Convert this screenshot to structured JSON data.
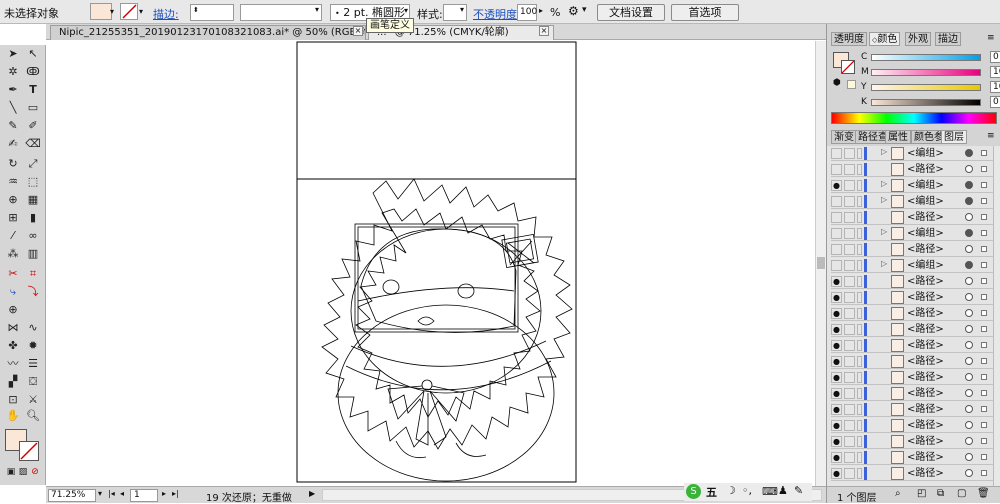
{
  "control_bar": {
    "selection_label": "未选择对象",
    "stroke_label": "描边:",
    "weight_value": "",
    "brush_value": "",
    "brush_pt": "2 pt.",
    "brush_shape": "椭圆形",
    "style_label": "样式:",
    "opacity_label": "不透明度",
    "opacity_value": "100",
    "percent": "%",
    "doc_setup_button": "文档设置",
    "preferences_button": "首选项",
    "tooltip": "画笔定义"
  },
  "document_tabs": [
    {
      "label": "Nipic_21255351_20190123170108321083.ai* @ 50% (RGB/轮廓)",
      "active": false
    },
    {
      "label": "...* @ 71.25% (CMYK/轮廓)",
      "active": true
    }
  ],
  "status_bar": {
    "zoom": "71.25%",
    "page": "1",
    "history": "19 次还原；无重做"
  },
  "panels": {
    "color_tabs": [
      "透明度",
      "颜色",
      "外观",
      "描边"
    ],
    "cmyk": [
      {
        "label": "C",
        "value": "0"
      },
      {
        "label": "M",
        "value": "10.16"
      },
      {
        "label": "Y",
        "value": "10.94"
      },
      {
        "label": "K",
        "value": "0"
      }
    ],
    "percent": "%",
    "layer_tabs": [
      "渐变",
      "路径查",
      "属性",
      "颜色参",
      "图层"
    ],
    "layers": [
      {
        "name": "<编组>",
        "eye": false,
        "expander": true,
        "filled": true
      },
      {
        "name": "<路径>",
        "eye": false,
        "expander": false,
        "filled": false
      },
      {
        "name": "<编组>",
        "eye": true,
        "expander": true,
        "filled": true
      },
      {
        "name": "<编组>",
        "eye": false,
        "expander": true,
        "filled": true
      },
      {
        "name": "<路径>",
        "eye": false,
        "expander": false,
        "filled": false
      },
      {
        "name": "<编组>",
        "eye": false,
        "expander": true,
        "filled": true
      },
      {
        "name": "<路径>",
        "eye": false,
        "expander": false,
        "filled": false
      },
      {
        "name": "<编组>",
        "eye": false,
        "expander": true,
        "filled": true
      },
      {
        "name": "<路径>",
        "eye": true,
        "expander": false,
        "filled": false
      },
      {
        "name": "<路径>",
        "eye": true,
        "expander": false,
        "filled": false
      },
      {
        "name": "<路径>",
        "eye": true,
        "expander": false,
        "filled": false
      },
      {
        "name": "<路径>",
        "eye": true,
        "expander": false,
        "filled": false
      },
      {
        "name": "<路径>",
        "eye": true,
        "expander": false,
        "filled": false
      },
      {
        "name": "<路径>",
        "eye": true,
        "expander": false,
        "filled": false
      },
      {
        "name": "<路径>",
        "eye": true,
        "expander": false,
        "filled": false
      },
      {
        "name": "<路径>",
        "eye": true,
        "expander": false,
        "filled": false
      },
      {
        "name": "<路径>",
        "eye": true,
        "expander": false,
        "filled": false
      },
      {
        "name": "<路径>",
        "eye": true,
        "expander": false,
        "filled": false
      },
      {
        "name": "<路径>",
        "eye": true,
        "expander": false,
        "filled": false
      },
      {
        "name": "<路径>",
        "eye": true,
        "expander": false,
        "filled": false
      },
      {
        "name": "<路径>",
        "eye": true,
        "expander": false,
        "filled": false
      }
    ],
    "layer_count": "1 个图层"
  },
  "tray": {
    "ime": "五"
  }
}
